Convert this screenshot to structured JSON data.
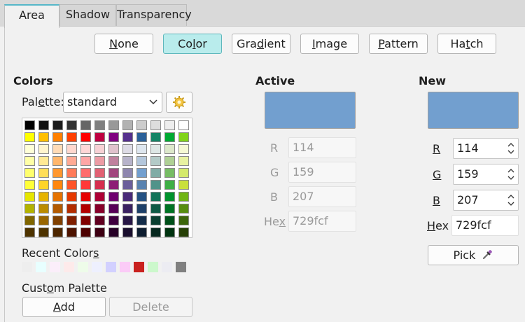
{
  "tabs": [
    {
      "label": "Area",
      "active": true
    },
    {
      "label": "Shadow",
      "active": false
    },
    {
      "label": "Transparency",
      "active": false
    }
  ],
  "fill_types": [
    {
      "pre": "",
      "u": "N",
      "post": "one",
      "selected": false
    },
    {
      "pre": "Co",
      "u": "l",
      "post": "or",
      "selected": true
    },
    {
      "pre": "Gra",
      "u": "d",
      "post": "ient",
      "selected": false
    },
    {
      "pre": "",
      "u": "I",
      "post": "mage",
      "selected": false
    },
    {
      "pre": "",
      "u": "P",
      "post": "attern",
      "selected": false
    },
    {
      "pre": "Ha",
      "u": "t",
      "post": "ch",
      "selected": false
    }
  ],
  "colors": {
    "heading": "Colors",
    "palette_label_pre": "Pal",
    "palette_label_u": "e",
    "palette_label_post": "tte:",
    "palette_value": "standard",
    "grid": [
      [
        "#000000",
        "#111111",
        "#1c1c1c",
        "#333333",
        "#666666",
        "#808080",
        "#999999",
        "#b2b2b2",
        "#cccccc",
        "#dddddd",
        "#eeeeee",
        "#ffffff"
      ],
      [
        "#ffff00",
        "#ffbf00",
        "#ff8000",
        "#ff4000",
        "#ff0000",
        "#bf0041",
        "#800080",
        "#55308d",
        "#2a6099",
        "#158466",
        "#00a933",
        "#81d41a"
      ],
      [
        "#ffffd7",
        "#fff5ce",
        "#ffdbb6",
        "#ffd8ce",
        "#ffd7d7",
        "#f7d1d5",
        "#e0c2cd",
        "#dedce6",
        "#dee6ef",
        "#dee7e5",
        "#dde8cb",
        "#f6f9d4"
      ],
      [
        "#ffffa6",
        "#ffe994",
        "#ffb66c",
        "#ffaa95",
        "#ffa6a6",
        "#ec9ba4",
        "#bf819e",
        "#b7b3ca",
        "#b4c7dc",
        "#b3cac7",
        "#afd095",
        "#e8f2a1"
      ],
      [
        "#ffff6d",
        "#ffde59",
        "#ff972f",
        "#ff7b59",
        "#ff6d6d",
        "#e16173",
        "#a1467e",
        "#8e86ae",
        "#729fcf",
        "#81aca6",
        "#77bc65",
        "#d4ea6b"
      ],
      [
        "#ffff38",
        "#ffd428",
        "#ff860d",
        "#ff5429",
        "#ff3838",
        "#d62e4e",
        "#8d1d75",
        "#6b5e9b",
        "#5983b0",
        "#50938a",
        "#3faf46",
        "#c9e03c"
      ],
      [
        "#e6e600",
        "#e6b300",
        "#e67300",
        "#e63900",
        "#e60000",
        "#ae0035",
        "#700070",
        "#4a2a7a",
        "#245283",
        "#127358",
        "#00932d",
        "#6fb514"
      ],
      [
        "#b3b300",
        "#bb8c00",
        "#b35a00",
        "#b32d00",
        "#b30000",
        "#87002a",
        "#570057",
        "#3a2161",
        "#1e4068",
        "#0e5a45",
        "#007324",
        "#578e10"
      ],
      [
        "#806600",
        "#996600",
        "#804000",
        "#802000",
        "#800000",
        "#610020",
        "#400040",
        "#281746",
        "#142d49",
        "#0a3f31",
        "#00501a",
        "#3d660b"
      ],
      [
        "#4d3300",
        "#4d3300",
        "#4d2600",
        "#4d1300",
        "#4d0000",
        "#3d0013",
        "#260026",
        "#1a0f2e",
        "#0e1e30",
        "#06281f",
        "#003310",
        "#264006"
      ]
    ],
    "recent_label_pre": "Recent Color",
    "recent_label_u": "s",
    "recent_label_post": "",
    "recent": [
      "#eeeeee",
      "#e8ffff",
      "#fbeefa",
      "#fdeaea",
      "#eefce9",
      "#eef0fe",
      "#d2d0ff",
      "#fbcbf7",
      "#c9211e",
      "#ccf8cc",
      "#ececf2",
      "#808080"
    ],
    "custom_label_pre": "Cust",
    "custom_label_u": "o",
    "custom_label_post": "m Palette",
    "add_pre": "",
    "add_u": "A",
    "add_post": "dd",
    "delete_label": "Delete"
  },
  "active": {
    "heading": "Active",
    "swatch_color": "#729fcf",
    "r_label": "R",
    "r_value": "114",
    "g_label": "G",
    "g_value": "159",
    "b_label": "B",
    "b_value": "207",
    "hex_pre": "He",
    "hex_u": "x",
    "hex_post": "",
    "hex_value": "729fcf"
  },
  "new": {
    "heading": "New",
    "swatch_color": "#729fcf",
    "r_label": "R",
    "r_value": "114",
    "g_label": "G",
    "g_value": "159",
    "b_label": "B",
    "b_value": "207",
    "hex_pre": "",
    "hex_u": "H",
    "hex_post": "ex",
    "hex_value": "729fcf",
    "pick_label": "Pick"
  }
}
